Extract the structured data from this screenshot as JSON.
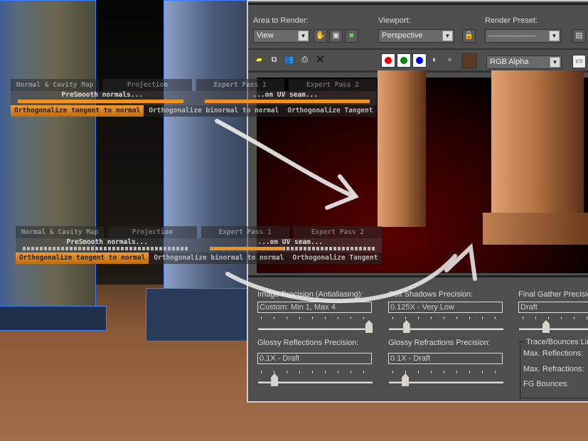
{
  "overlay_top": {
    "tabs": [
      "Normal & Cavity Map",
      "Projection",
      "Expert Pass 1",
      "Expert Pass 2"
    ],
    "presmooth_label": "PreSmooth normals...",
    "uvseam_label": "...on UV seam...",
    "presmooth_value": 1.0,
    "uvseam_value": 1.0,
    "buttons": [
      "Orthogonalize  tangent to normal",
      "Orthogonalize  binormal to normal",
      "Orthogonalize Tangent"
    ]
  },
  "overlay_bottom": {
    "tabs": [
      "Normal & Cavity Map",
      "Projection",
      "Expert Pass 1",
      "Expert Pass 2"
    ],
    "presmooth_label": "PreSmooth normals...",
    "uvseam_label": "...on UV seam...",
    "presmooth_value": 0.0,
    "uvseam_value": 0.45,
    "buttons": [
      "Orthogonalize  tangent to normal",
      "Orthogonalize  binormal to normal",
      "Orthogonalize Tangent"
    ]
  },
  "render": {
    "area_label": "Area to Render:",
    "area_value": "View",
    "viewport_label": "Viewport:",
    "viewport_value": "Perspective",
    "preset_label": "Render Preset:",
    "preset_value": "-------------------------",
    "channel_value": "RGB Alpha",
    "icons": [
      "save-icon",
      "copy-icon",
      "clone-icon",
      "print-icon",
      "clear-icon"
    ],
    "colors": {
      "red": "#ee0000",
      "green": "#008800",
      "blue": "#0000ee",
      "swatch": "#5a3a20"
    }
  },
  "precision": {
    "image": {
      "label": "Image Precision (Antialiasing):",
      "value": "Custom: Min 1, Max 4",
      "slider": 1.0
    },
    "soft": {
      "label": "Soft Shadows Precision:",
      "value": "0.125X - Very Low",
      "slider": 0.13
    },
    "fg": {
      "label": "Final Gather Precision",
      "value": "Draft",
      "slider": 0.3
    },
    "glossy_refl": {
      "label": "Glossy Reflections Precision:",
      "value": "0.1X - Draft",
      "slider": 0.12
    },
    "glossy_refr": {
      "label": "Glossy Refractions Precision:",
      "value": "0.1X - Draft",
      "slider": 0.12
    },
    "trace": {
      "title": "Trace/Bounces Limi",
      "max_refl": "Max. Reflections:",
      "max_refr": "Max. Refractions:",
      "fg_bounces": "FG Bounces:"
    }
  }
}
